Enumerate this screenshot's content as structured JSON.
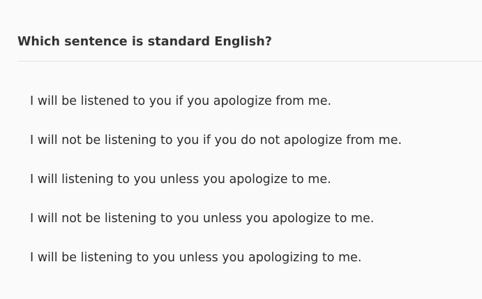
{
  "question": {
    "title": "Which sentence is standard English?",
    "options": [
      "I will be listened to you if you apologize from me.",
      "I will not be listening to you if you do not apologize from me.",
      "I will listening to you unless you apologize to me.",
      "I will not be listening to you unless you apologize to me.",
      "I will be listening to you unless you apologizing to me."
    ]
  },
  "colors": {
    "background": "#fafafa",
    "text": "#2b2b2b",
    "divider": "#e2e2e2"
  }
}
